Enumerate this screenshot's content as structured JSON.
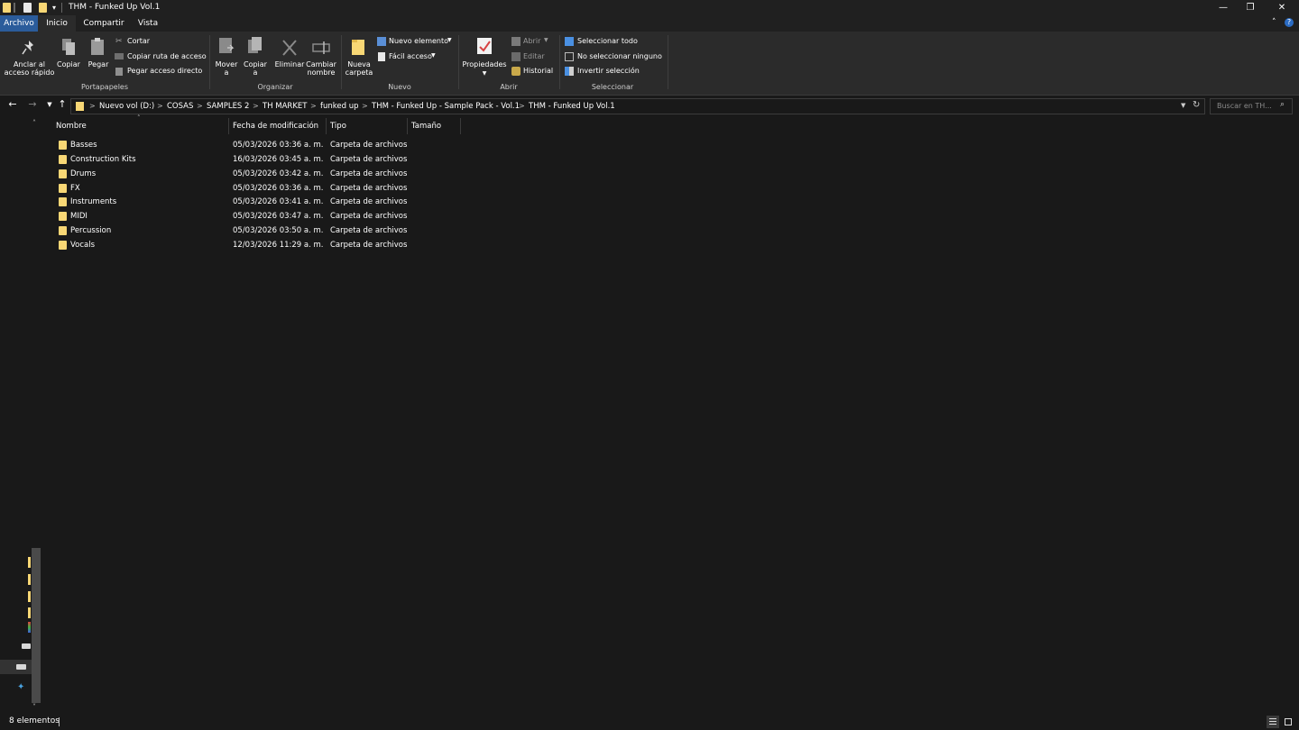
{
  "window": {
    "title": "THM - Funked Up Vol.1",
    "minimize_glyph": "—",
    "maximize_glyph": "❐",
    "close_glyph": "✕"
  },
  "tabs": [
    "Archivo",
    "Inicio",
    "Compartir",
    "Vista"
  ],
  "ribbon": {
    "portapapeles": {
      "title": "Portapapeles",
      "pin_l1": "Anclar al",
      "pin_l2": "acceso rápido",
      "copy": "Copiar",
      "paste": "Pegar",
      "cut": "Cortar",
      "copy_path": "Copiar ruta de acceso",
      "paste_shortcut": "Pegar acceso directo"
    },
    "organizar": {
      "title": "Organizar",
      "move_l1": "Mover",
      "move_l2": "a",
      "copy_l1": "Copiar",
      "copy_l2": "a",
      "delete": "Eliminar",
      "rename_l1": "Cambiar",
      "rename_l2": "nombre"
    },
    "nuevo": {
      "title": "Nuevo",
      "new_folder_l1": "Nueva",
      "new_folder_l2": "carpeta",
      "new_item": "Nuevo elemento",
      "easy_access": "Fácil acceso"
    },
    "abrir": {
      "title": "Abrir",
      "properties": "Propiedades",
      "open": "Abrir",
      "edit": "Editar",
      "history": "Historial"
    },
    "seleccionar": {
      "title": "Seleccionar",
      "select_all": "Seleccionar todo",
      "select_none": "No seleccionar ninguno",
      "invert": "Invertir selección"
    }
  },
  "address": {
    "crumbs": [
      "Nuevo vol (D:)",
      "COSAS",
      "SAMPLES 2",
      "TH MARKET",
      "funked up",
      "THM - Funked Up - Sample Pack - Vol.1",
      "THM - Funked Up Vol.1"
    ],
    "search_placeholder": "Buscar en TH..."
  },
  "columns": [
    "Nombre",
    "Fecha de modificación",
    "Tipo",
    "Tamaño"
  ],
  "files": [
    {
      "name": "Basses",
      "date": "05/03/2026 03:36 a. m.",
      "type": "Carpeta de archivos"
    },
    {
      "name": "Construction Kits",
      "date": "16/03/2026 03:45 a. m.",
      "type": "Carpeta de archivos"
    },
    {
      "name": "Drums",
      "date": "05/03/2026 03:42 a. m.",
      "type": "Carpeta de archivos"
    },
    {
      "name": "FX",
      "date": "05/03/2026 03:36 a. m.",
      "type": "Carpeta de archivos"
    },
    {
      "name": "Instruments",
      "date": "05/03/2026 03:41 a. m.",
      "type": "Carpeta de archivos"
    },
    {
      "name": "MIDI",
      "date": "05/03/2026 03:47 a. m.",
      "type": "Carpeta de archivos"
    },
    {
      "name": "Percussion",
      "date": "05/03/2026 03:50 a. m.",
      "type": "Carpeta de archivos"
    },
    {
      "name": "Vocals",
      "date": "12/03/2026 11:29 a. m.",
      "type": "Carpeta de archivos"
    }
  ],
  "status": {
    "count": "8 elementos"
  },
  "colors": {
    "folder": "#f8d775",
    "accent": "#2b5c9b",
    "background": "#191919",
    "ribbon": "#2b2b2b"
  }
}
